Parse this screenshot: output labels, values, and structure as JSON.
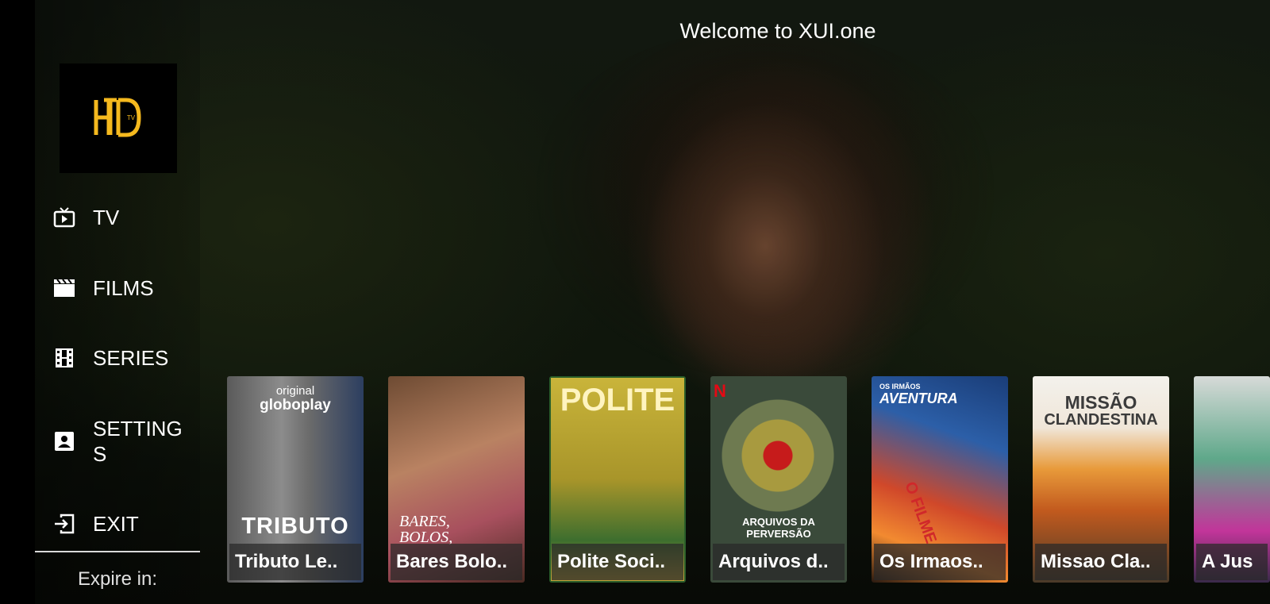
{
  "header": {
    "welcome": "Welcome to XUI.one"
  },
  "logo": {
    "text": "HD",
    "badge": "TV",
    "color": "#f5b91e"
  },
  "sidebar": {
    "items": [
      {
        "label": "TV",
        "icon": "tv-icon"
      },
      {
        "label": "FILMS",
        "icon": "clapperboard-icon"
      },
      {
        "label": "SERIES",
        "icon": "film-strip-icon"
      },
      {
        "label": "SETTINGS",
        "icon": "contact-card-icon"
      },
      {
        "label": "EXIT",
        "icon": "exit-icon"
      }
    ],
    "expire_label": "Expire in:"
  },
  "posters": [
    {
      "title": "Tributo  Le..",
      "art_text": [
        "original",
        "globoplay",
        "TRIBUTO"
      ]
    },
    {
      "title": "Bares Bolo..",
      "art_text": [
        "BARES,",
        "BOLOS,"
      ]
    },
    {
      "title": "Polite Soci..",
      "art_text": [
        "POLITE"
      ]
    },
    {
      "title": "Arquivos d..",
      "art_text": [
        "N",
        "ARQUIVOS DA PERVERSÃO"
      ]
    },
    {
      "title": "Os Irmaos..",
      "art_text": [
        "OS IRMÃOS",
        "AVENTURA",
        "O FILME"
      ]
    },
    {
      "title": "Missao Cla..",
      "art_text": [
        "MISSÃO",
        "CLANDESTINA"
      ]
    },
    {
      "title": "A Jus",
      "art_text": []
    }
  ]
}
